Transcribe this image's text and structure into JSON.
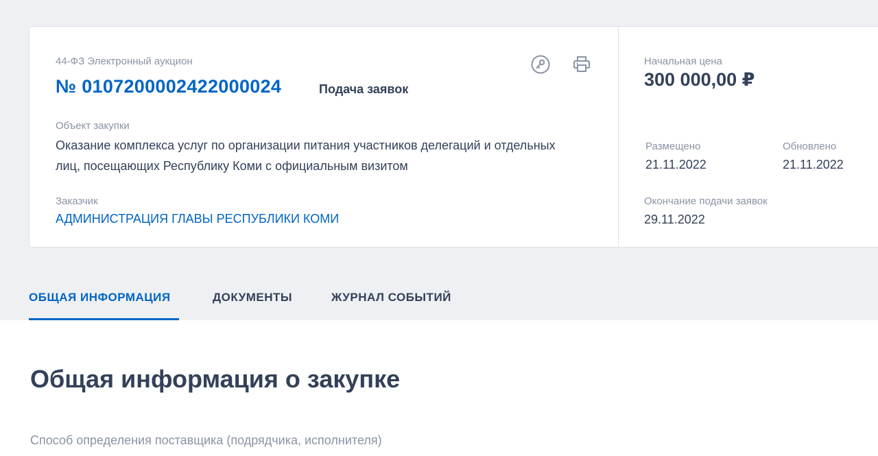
{
  "card": {
    "law_type": "44-ФЗ Электронный аукцион",
    "reg_number": "№ 0107200002422000024",
    "stage": "Подача заявок",
    "object_label": "Объект закупки",
    "object_text": "Оказание комплекса услуг по организации питания участников делегаций и отдельных лиц, посещающих Республику Коми с официальным визитом",
    "customer_label": "Заказчик",
    "customer_name": "АДМИНИСТРАЦИЯ ГЛАВЫ РЕСПУБЛИКИ КОМИ",
    "icons": [
      "key-icon",
      "printer-icon"
    ]
  },
  "price": {
    "label": "Начальная цена",
    "value": "300 000,00 ₽"
  },
  "dates": {
    "posted_label": "Размещено",
    "posted_value": "21.11.2022",
    "updated_label": "Обновлено",
    "updated_value": "21.11.2022",
    "deadline_label": "Окончание подачи заявок",
    "deadline_value": "29.11.2022"
  },
  "tabs": [
    {
      "label": "ОБЩАЯ ИНФОРМАЦИЯ",
      "active": true
    },
    {
      "label": "ДОКУМЕНТЫ",
      "active": false
    },
    {
      "label": "ЖУРНАЛ СОБЫТИЙ",
      "active": false
    }
  ],
  "main": {
    "section_title": "Общая информация о закупке",
    "method_label": "Способ определения поставщика (подрядчика, исполнителя)"
  },
  "colors": {
    "accent": "#0065c4",
    "text": "#334059",
    "muted": "#8a93a3",
    "band": "#eef0f3"
  }
}
